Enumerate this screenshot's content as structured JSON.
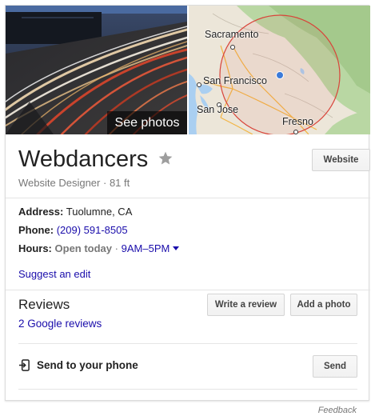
{
  "media": {
    "see_photos_label": "See photos",
    "map_labels": {
      "sacramento": "Sacramento",
      "san_francisco": "San Francisco",
      "san_jose": "San Jose",
      "fresno": "Fresno"
    }
  },
  "business": {
    "name": "Webdancers",
    "category": "Website Designer",
    "distance": "81 ft",
    "separator": " · "
  },
  "actions": {
    "website_label": "Website",
    "write_review_label": "Write a review",
    "add_photo_label": "Add a photo",
    "send_label": "Send"
  },
  "details": {
    "address_label": "Address:",
    "address_value": "Tuolumne, CA",
    "phone_label": "Phone:",
    "phone_value": "(209) 591-8505",
    "hours_label": "Hours:",
    "hours_status": "Open today",
    "hours_separator": "·",
    "hours_value": "9AM–5PM"
  },
  "suggest_edit_label": "Suggest an edit",
  "reviews": {
    "title": "Reviews",
    "count_label": "2 Google reviews"
  },
  "send_to_phone_label": "Send to your phone",
  "feedback_label": "Feedback",
  "icons": {
    "star": "star-icon",
    "send": "send-to-phone-icon",
    "caret": "chevron-down-icon"
  },
  "colors": {
    "link": "#1a0dab",
    "star": "#9e9e9e",
    "map_circle": "#d9443a",
    "map_pin": "#3b7bd9"
  }
}
